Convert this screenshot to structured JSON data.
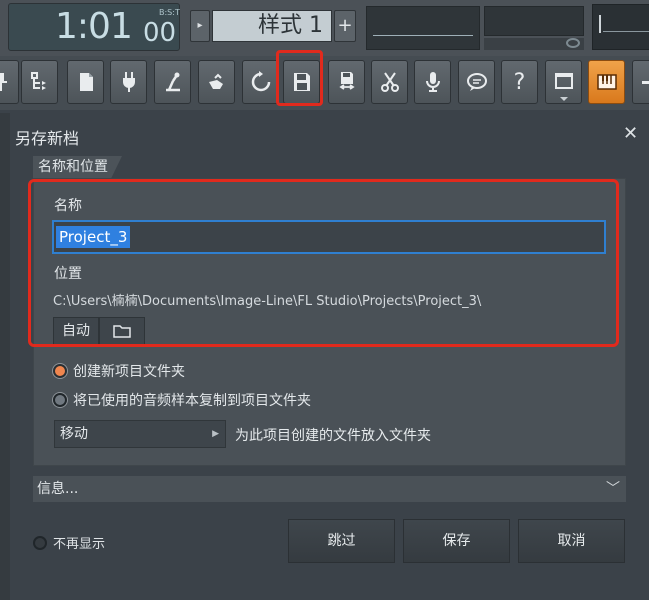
{
  "transport": {
    "time_main": "1:01",
    "time_sub": "00",
    "time_label": "B:S:T",
    "pattern_label": "样式 1",
    "plus_label": "+",
    "prev_arrow": "▸"
  },
  "toolbar": {
    "icons": [
      "pin-icon",
      "step-icon",
      "file-icon",
      "plug-icon",
      "mixer-icon",
      "hand-icon",
      "refresh-icon",
      "save-icon",
      "save-as-icon",
      "cut-icon",
      "mic-icon",
      "chat-icon",
      "help-icon",
      "window-icon",
      "keyboard-icon",
      "minus-icon"
    ],
    "help_label": "?",
    "accent_color": "#e8923a",
    "highlight_color": "#e12a1d"
  },
  "dialog": {
    "title": "另存新档",
    "close": "✕",
    "section_tab": "名称和位置",
    "name_label": "名称",
    "name_value": "Project_3",
    "location_label": "位置",
    "location_path": "C:\\Users\\楠楠\\Documents\\Image-Line\\FL Studio\\Projects\\Project_3\\",
    "auto_label": "自动",
    "option_create_folder": "创建新项目文件夹",
    "option_copy_samples": "将已使用的音频样本复制到项目文件夹",
    "move_select_value": "移动",
    "move_description": "为此项目创建的文件放入文件夹",
    "info_label": "信息...",
    "dont_show_label": "不再显示",
    "skip_label": "跳过",
    "save_label": "保存",
    "cancel_label": "取消"
  }
}
